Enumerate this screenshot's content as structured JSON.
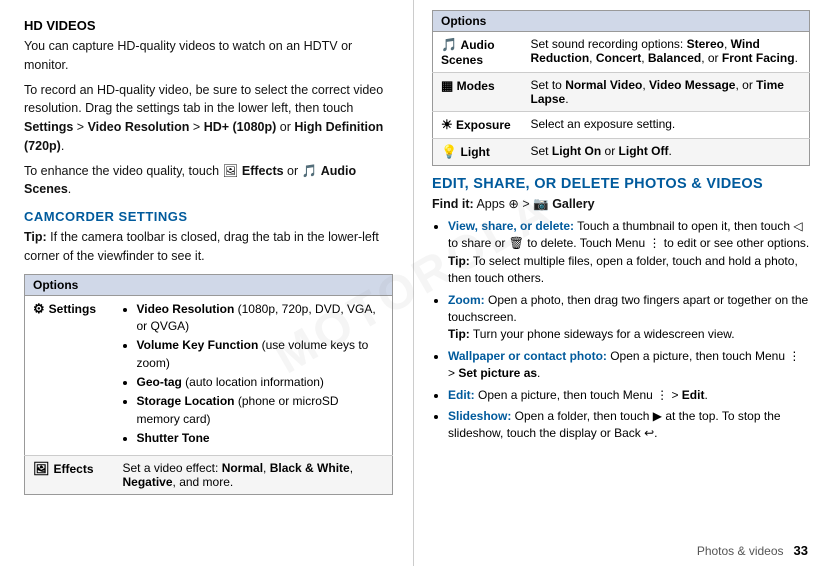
{
  "page": {
    "footer": {
      "section_label": "Photos & videos",
      "page_number": "33"
    }
  },
  "left": {
    "hd_heading": "HD VIDEOS",
    "para1": "You can capture HD-quality videos to watch on an HDTV or monitor.",
    "para2": "To record an HD-quality video, be sure to select the correct video resolution. Drag the settings tab in the lower left, then touch Settings > Video Resolution > HD+ (1080p) or High Definition (720p).",
    "para3_prefix": "To enhance the video quality, touch",
    "para3_effects": "Effects",
    "para3_or": "or",
    "para3_audio": "Audio Scenes",
    "para3_period": ".",
    "camcorder_heading": "CAMCORDER SETTINGS",
    "tip_label": "Tip:",
    "tip_text": "If the camera toolbar is closed, drag the tab in the lower-left corner of the viewfinder to see it.",
    "table": {
      "header": "Options",
      "rows": [
        {
          "icon": "⚙",
          "label": "Settings",
          "content_type": "list",
          "bullets": [
            {
              "bold": "Video Resolution",
              "rest": " (1080p, 720p, DVD, VGA, or QVGA)"
            },
            {
              "bold": "Volume Key Function",
              "rest": " (use volume keys to zoom)"
            },
            {
              "bold": "Geo-tag",
              "rest": " (auto location information)"
            },
            {
              "bold": "Storage Location",
              "rest": " (phone or microSD memory card)"
            },
            {
              "bold": "Shutter Tone",
              "rest": ""
            }
          ]
        },
        {
          "icon": "🎨",
          "label": "Effects",
          "content_type": "text",
          "text_prefix": "Set a video effect: ",
          "bold_parts": [
            "Normal",
            "Black & White",
            "Negative"
          ],
          "text_suffix": ", and more."
        }
      ]
    }
  },
  "right": {
    "top_table": {
      "header": "Options",
      "rows": [
        {
          "icon": "🎵",
          "label": "Audio Scenes",
          "text": "Set sound recording options: Stereo, Wind Reduction, Concert, Balanced, or Front Facing.",
          "bold_in_text": [
            "Stereo",
            "Wind Reduction",
            "Concert",
            "Balanced",
            "Front Facing"
          ]
        },
        {
          "icon": "▦",
          "label": "Modes",
          "text": "Set to Normal Video, Video Message, or Time Lapse.",
          "bold_in_text": [
            "Normal Video",
            "Video Message",
            "Time Lapse"
          ]
        },
        {
          "icon": "☀",
          "label": "Exposure",
          "text": "Select an exposure setting.",
          "bold_in_text": []
        },
        {
          "icon": "💡",
          "label": "Light",
          "text": "Set Light On or Light Off.",
          "bold_in_text": [
            "Light On",
            "Light Off"
          ]
        }
      ]
    },
    "edit_heading": "EDIT, SHARE, OR DELETE PHOTOS & VIDEOS",
    "find_label": "Find it:",
    "find_text": "Apps  >  Gallery",
    "bullets": [
      {
        "term": "View, share, or delete:",
        "text": "Touch a thumbnail to open it, then touch  to share or  to delete. Touch Menu  to edit or see other options.",
        "tip": "Tip: To select multiple files, open a folder, touch and hold a photo, then touch others."
      },
      {
        "term": "Zoom:",
        "text": "Open a photo, then drag two fingers apart or together on the touchscreen.",
        "tip": "Tip: Turn your phone sideways for a widescreen view."
      },
      {
        "term": "Wallpaper or contact photo:",
        "text": "Open a picture, then touch Menu  > Set picture as.",
        "tip": null
      },
      {
        "term": "Edit:",
        "text": "Open a picture, then touch Menu  > Edit.",
        "tip": null
      },
      {
        "term": "Slideshow:",
        "text": "Open a folder, then touch  at the top. To stop the slideshow, touch the display or Back.",
        "tip": null
      }
    ]
  }
}
